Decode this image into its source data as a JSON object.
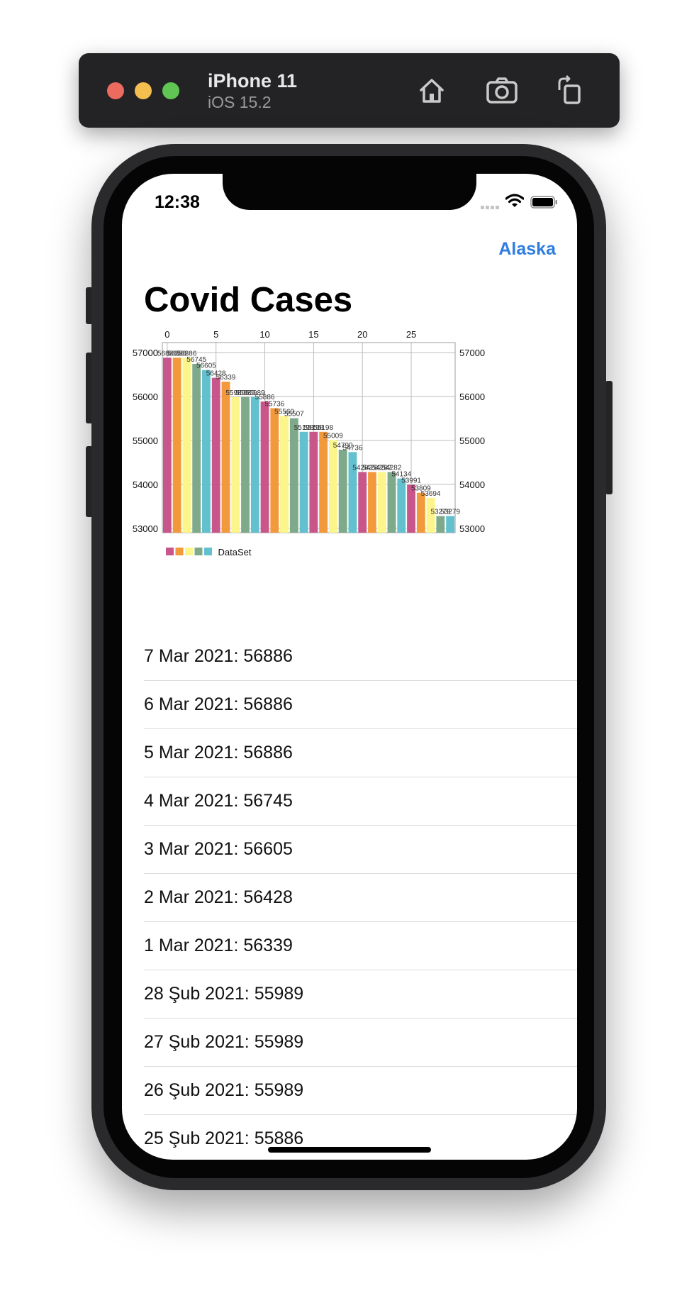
{
  "simulator": {
    "device_name": "iPhone 11",
    "os_version": "iOS 15.2",
    "toolbar_icons": [
      "home-icon",
      "screenshot-icon",
      "rotate-icon"
    ]
  },
  "status_bar": {
    "time": "12:38",
    "icons": [
      "signal-icon",
      "wifi-icon",
      "battery-icon"
    ]
  },
  "nav": {
    "title": "Covid Cases",
    "right_button": "Alaska"
  },
  "colors": {
    "accent": "#2f7de1",
    "series": [
      "#c8568a",
      "#f29a3b",
      "#fbf58c",
      "#7ea98a",
      "#62c0cf"
    ]
  },
  "chart_data": {
    "type": "bar",
    "x": [
      0,
      1,
      2,
      3,
      4,
      5,
      6,
      7,
      8,
      9,
      10,
      11,
      12,
      13,
      14,
      15,
      16,
      17,
      18,
      19,
      20,
      21,
      22,
      23,
      24,
      25,
      26,
      27,
      28,
      29
    ],
    "values": [
      56886,
      56886,
      56886,
      56745,
      56605,
      56428,
      56339,
      55989,
      55989,
      55989,
      55886,
      55736,
      55560,
      55507,
      55198,
      55198,
      55198,
      55009,
      54790,
      54736,
      54282,
      54282,
      54282,
      54282,
      54134,
      53991,
      53809,
      53694,
      53279,
      53279
    ],
    "data_labels": [
      "56886",
      "56886",
      "56886",
      "56745",
      "56605",
      "56428",
      "56339",
      "55989",
      "55989",
      "55989",
      "55886",
      "55736",
      "55560",
      "55507",
      "55198",
      "55198",
      "55198",
      "55009",
      "54790",
      "54736",
      "54282",
      "54282",
      "54282",
      "54282",
      "54134",
      "53991",
      "53809",
      "53694",
      "53279",
      "53279"
    ],
    "x_ticks": [
      "0",
      "5",
      "10",
      "15",
      "20",
      "25"
    ],
    "x_tick_values": [
      0,
      5,
      10,
      15,
      20,
      25
    ],
    "y_ticks": [
      "53000",
      "54000",
      "55000",
      "56000",
      "57000"
    ],
    "y_tick_values": [
      53000,
      54000,
      55000,
      56000,
      57000
    ],
    "xlim": [
      -0.5,
      29.5
    ],
    "ylim": [
      52900,
      57230
    ],
    "x_axis_position": "top",
    "y_axis": "left and right",
    "grid": true,
    "legend": {
      "label": "DataSet",
      "position": "bottom-left"
    }
  },
  "list_items": [
    "7 Mar 2021: 56886",
    "6 Mar 2021: 56886",
    "5 Mar 2021: 56886",
    "4 Mar 2021: 56745",
    "3 Mar 2021: 56605",
    "2 Mar 2021: 56428",
    "1 Mar 2021: 56339",
    "28 Şub 2021: 55989",
    "27 Şub 2021: 55989",
    "26 Şub 2021: 55989",
    "25 Şub 2021: 55886"
  ]
}
